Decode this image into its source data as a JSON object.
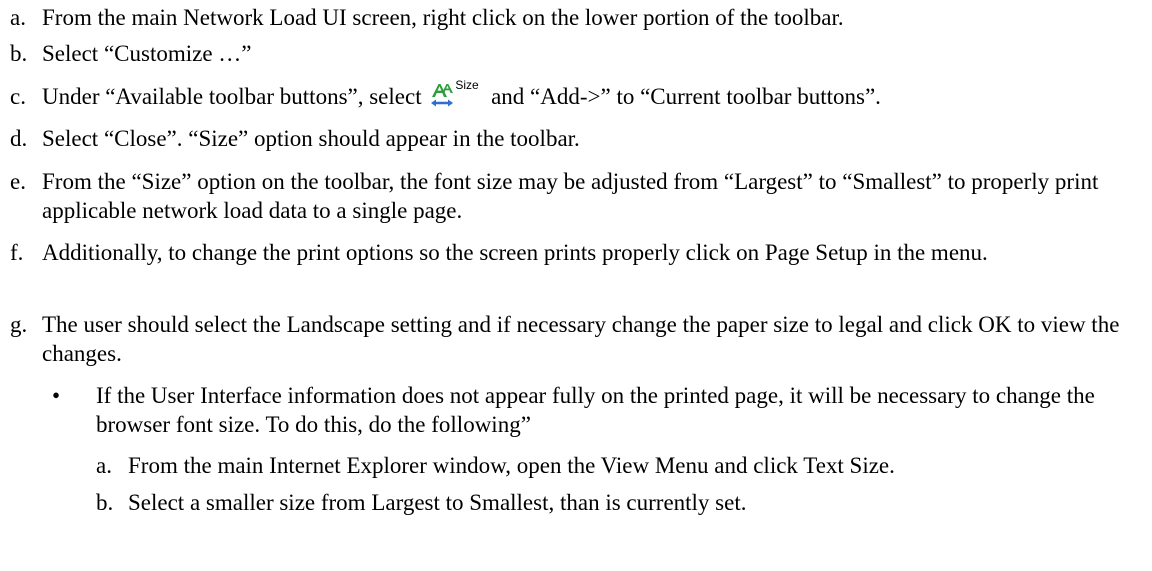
{
  "steps": [
    {
      "letter": "a.",
      "text": "From the main Network Load UI screen, right click on the lower portion of the toolbar."
    },
    {
      "letter": "b.",
      "text": "Select “Customize …”"
    },
    {
      "letter": "c.",
      "text_before": "Under “Available toolbar buttons”, select",
      "icon_label": "Size",
      "text_after": "and “Add->” to “Current toolbar buttons”."
    },
    {
      "letter": "d.",
      "text": "Select “Close”.  “Size” option should appear in the toolbar."
    },
    {
      "letter": "e.",
      "text": "From the “Size” option on the toolbar, the font size may be adjusted from “Largest” to “Smallest” to properly print applicable network load data to a single page."
    },
    {
      "letter": "f.",
      "text": "Additionally, to change the print options so the screen prints properly click on Page Setup in the menu."
    },
    {
      "letter": "g.",
      "text": "The user should select the Landscape setting and if necessary change the paper size to legal and click OK to view the changes."
    }
  ],
  "bullet": {
    "symbol": "•",
    "text": "If the User Interface information does not appear fully on the printed page, it will be necessary to change the browser font size. To do this, do the following”"
  },
  "sub_steps": [
    {
      "letter": "a.",
      "text": "From the main Internet Explorer window, open the View Menu and click Text Size."
    },
    {
      "letter": "b.",
      "text": "Select a smaller size from Largest to Smallest, than is currently set."
    }
  ],
  "icon": {
    "name": "size-icon",
    "letter_color": "#2e9e3a",
    "arrow_color": "#2f6fd0"
  }
}
